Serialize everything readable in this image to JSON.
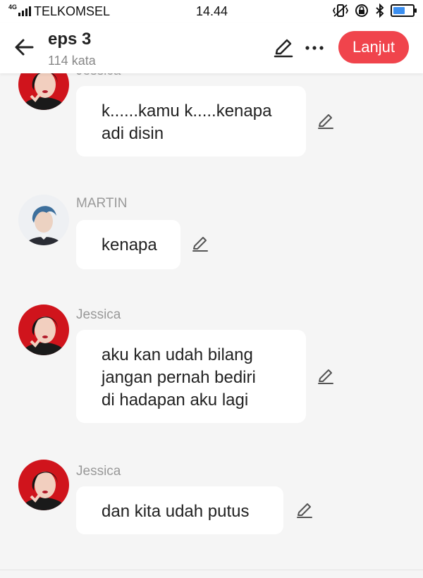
{
  "status_bar": {
    "network": "4G",
    "carrier": "TELKOMSEL",
    "time": "14.44",
    "battery_percent": 0.6
  },
  "header": {
    "title": "eps 3",
    "subtitle": "114 kata",
    "continue_label": "Lanjut",
    "accent_color": "#f0444c"
  },
  "messages": [
    {
      "sender": "Jessica",
      "text": "k......kamu k.....kenapa\nadi disin",
      "avatar": "jessica-avatar"
    },
    {
      "sender": "MARTIN",
      "text": "kenapa",
      "avatar": "martin-avatar"
    },
    {
      "sender": "Jessica",
      "text": "aku kan udah bilang\njangan pernah bediri\ndi hadapan aku lagi",
      "avatar": "jessica-avatar"
    },
    {
      "sender": "Jessica",
      "text": "dan kita udah putus",
      "avatar": "jessica-avatar"
    }
  ],
  "icons": [
    "back-arrow-icon",
    "pencil-icon",
    "more-dots-icon"
  ]
}
